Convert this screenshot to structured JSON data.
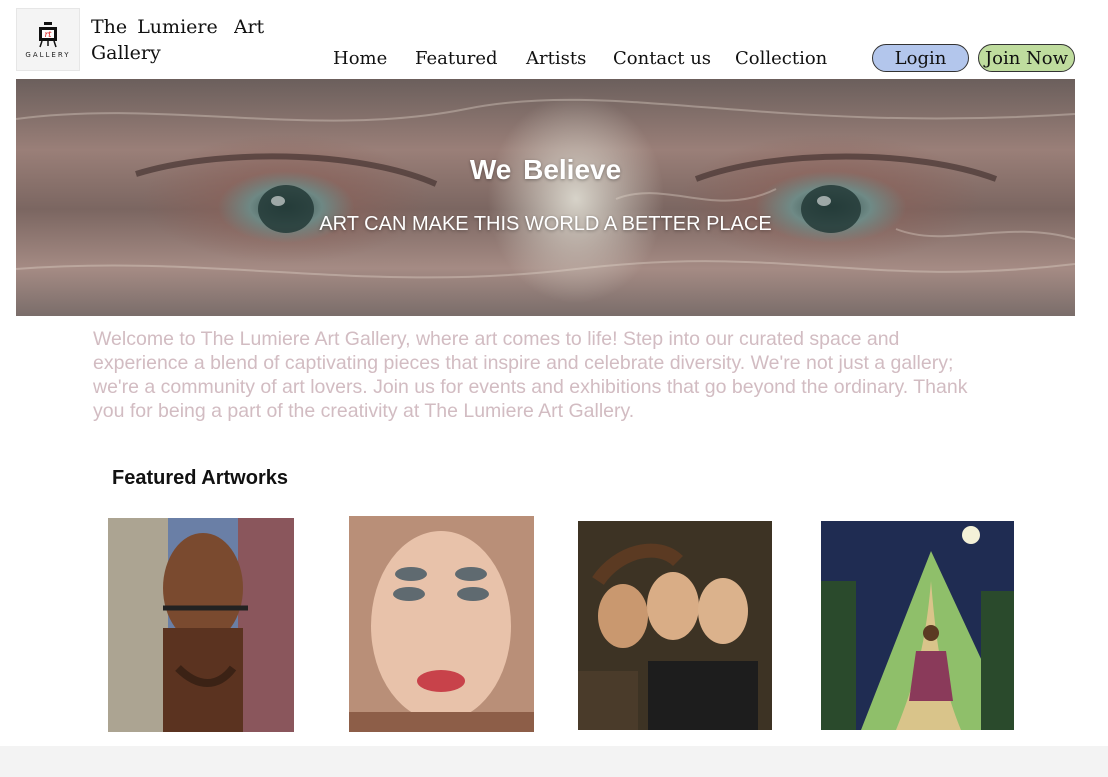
{
  "site": {
    "logo_text": "GALLERY",
    "title_line1": "The Lumiere",
    "title_word_art": "Art",
    "title_line2": "Gallery"
  },
  "nav": {
    "items": [
      {
        "label": "Home"
      },
      {
        "label": "Featured"
      },
      {
        "label": "Artists"
      },
      {
        "label": "Contact us"
      },
      {
        "label": "Collection"
      }
    ]
  },
  "auth": {
    "login_label": "Login",
    "join_label": "Join Now"
  },
  "hero": {
    "title": "We  Believe",
    "subtitle": "ART CAN MAKE THIS WORLD A BETTER PLACE"
  },
  "intro": {
    "text": "Welcome to The Lumiere Art Gallery, where art comes to life! Step into our curated space and experience a blend of captivating pieces that inspire and celebrate diversity. We're not just a gallery; we're a community of art lovers. Join us for events and exhibitions that go beyond the ordinary. Thank you for being a part of the creativity at The Lumiere Art Gallery."
  },
  "featured": {
    "heading": "Featured Artworks",
    "artworks": [
      {
        "icon": "barbed-wire-portrait-painting"
      },
      {
        "icon": "multiple-eyes-portrait-painting"
      },
      {
        "icon": "three-women-painting"
      },
      {
        "icon": "moonlit-landscape-painting"
      }
    ]
  },
  "colors": {
    "login_button": "#b3c6ec",
    "join_button": "#bfdc9e",
    "intro_text": "#d2bcc2",
    "footer_strip": "#f3f3f3"
  }
}
